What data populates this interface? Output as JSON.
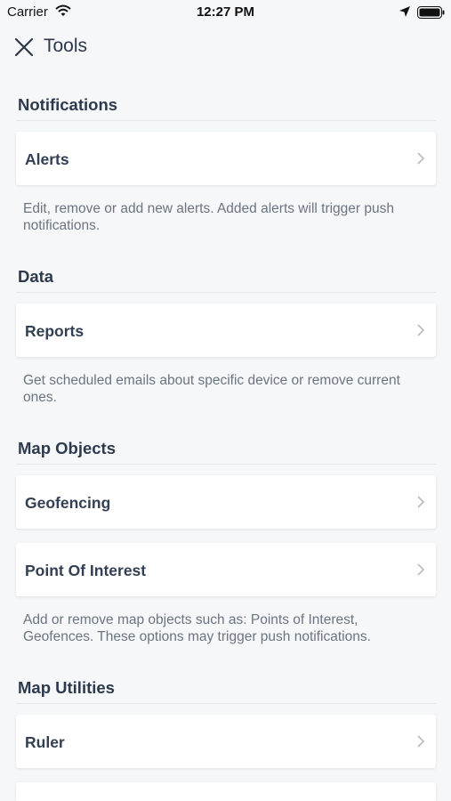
{
  "status_bar": {
    "carrier": "Carrier",
    "time": "12:27 PM"
  },
  "nav": {
    "title": "Tools"
  },
  "sections": {
    "notifications": {
      "title": "Notifications",
      "items": [
        {
          "label": "Alerts"
        }
      ],
      "description": "Edit, remove or add new alerts. Added alerts will trigger push notifications."
    },
    "data": {
      "title": "Data",
      "items": [
        {
          "label": "Reports"
        }
      ],
      "description": "Get scheduled emails about specific device or remove current ones."
    },
    "map_objects": {
      "title": "Map Objects",
      "items": [
        {
          "label": "Geofencing"
        },
        {
          "label": "Point Of Interest"
        }
      ],
      "description": "Add or remove map objects such as: Points of Interest, Geofences. These options may trigger push notifications."
    },
    "map_utilities": {
      "title": "Map Utilities",
      "items": [
        {
          "label": "Ruler"
        },
        {
          "label": ""
        }
      ]
    }
  }
}
